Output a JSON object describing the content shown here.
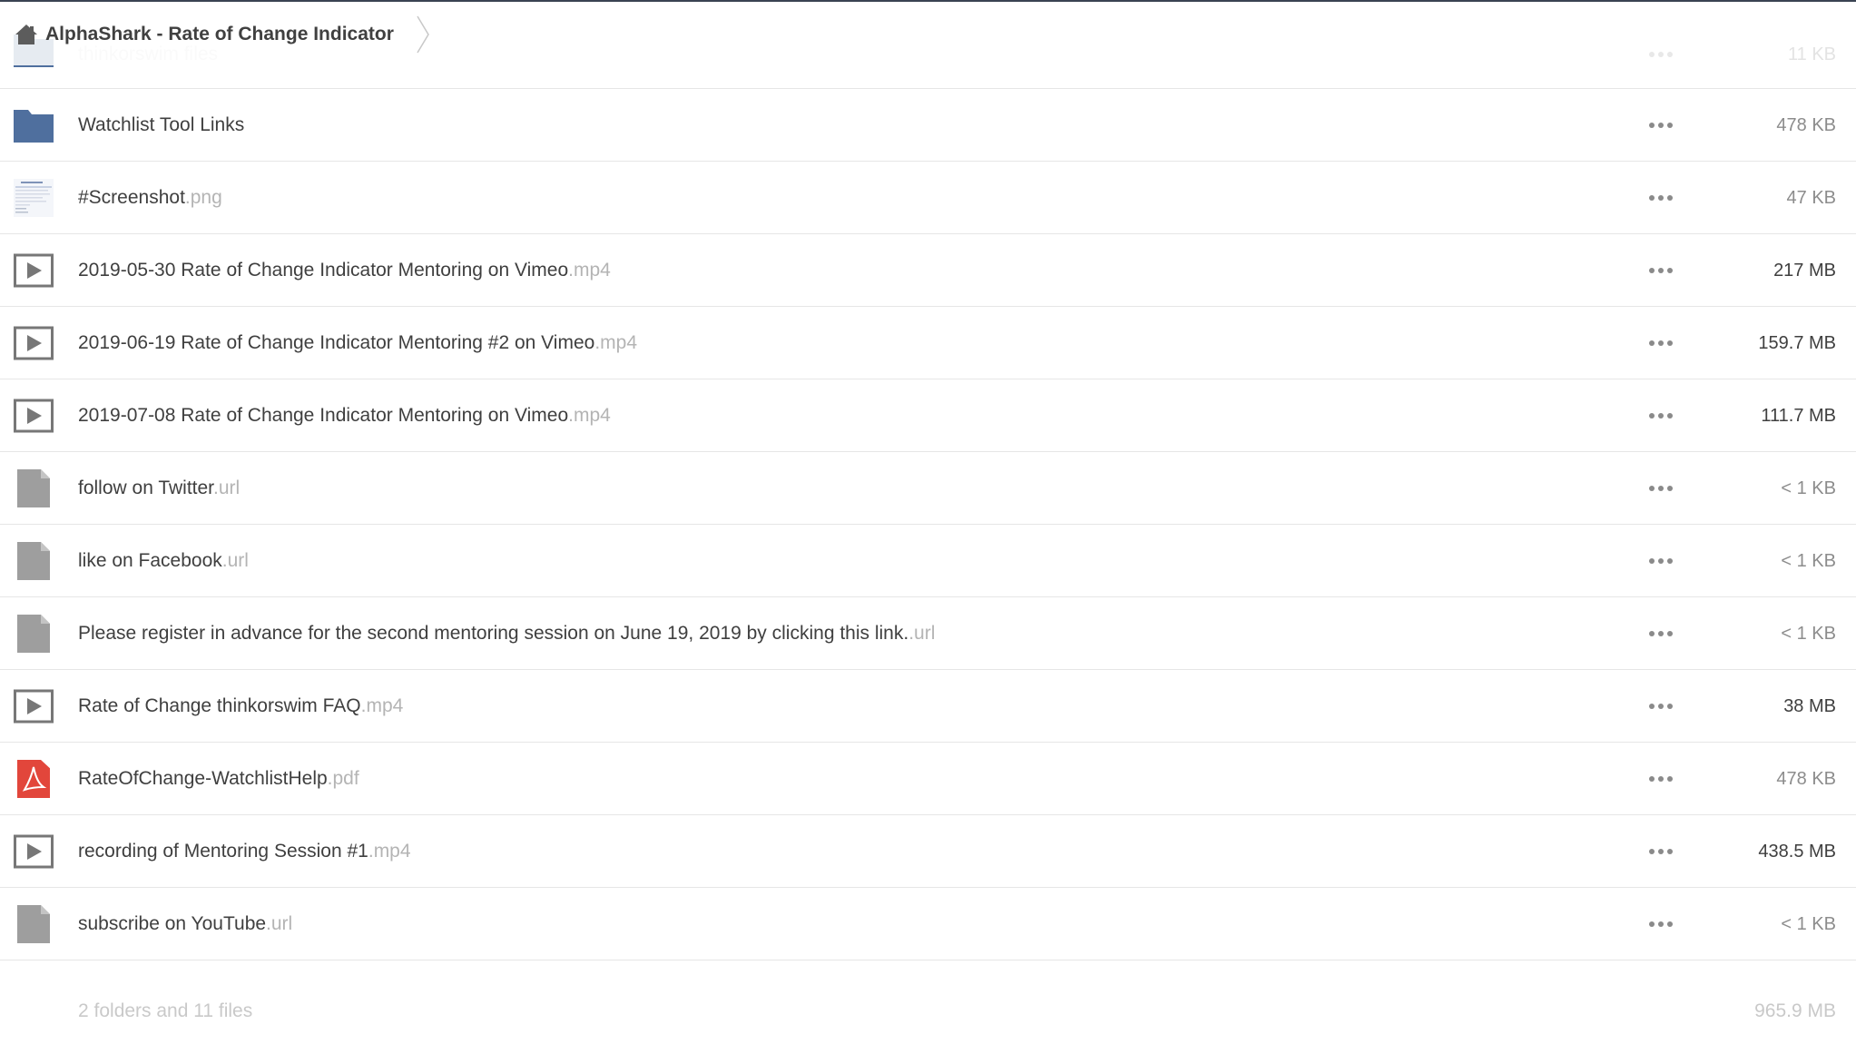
{
  "breadcrumb": {
    "title": "AlphaShark - Rate of Change Indicator",
    "home_icon": "home-icon",
    "separator_icon": "chevron-right-icon"
  },
  "colors": {
    "folder": "#4f6f9e",
    "video_outline": "#777777",
    "generic_file": "#9e9e9e",
    "pdf": "#e2463b",
    "divider": "#e6e6e6",
    "top_border": "#3a4352"
  },
  "files": [
    {
      "name": "thinkorswim files",
      "ext": "",
      "size": "11 KB",
      "icon": "folder-icon",
      "partial": true
    },
    {
      "name": "Watchlist Tool Links",
      "ext": "",
      "size": "478 KB",
      "icon": "folder-icon"
    },
    {
      "name": "#Screenshot",
      "ext": ".png",
      "size": "47 KB",
      "icon": "image-thumbnail-icon"
    },
    {
      "name": "2019-05-30 Rate of Change Indicator Mentoring on Vimeo",
      "ext": ".mp4",
      "size": "217 MB",
      "icon": "video-icon",
      "dark": true
    },
    {
      "name": "2019-06-19 Rate of Change Indicator Mentoring #2 on Vimeo",
      "ext": ".mp4",
      "size": "159.7 MB",
      "icon": "video-icon",
      "dark": true
    },
    {
      "name": "2019-07-08 Rate of Change Indicator Mentoring on Vimeo",
      "ext": ".mp4",
      "size": "111.7 MB",
      "icon": "video-icon",
      "dark": true
    },
    {
      "name": "follow on Twitter",
      "ext": ".url",
      "size": "< 1 KB",
      "icon": "file-icon"
    },
    {
      "name": "like on Facebook",
      "ext": ".url",
      "size": "< 1 KB",
      "icon": "file-icon"
    },
    {
      "name": "Please register in advance for the second mentoring session on June 19, 2019 by clicking this link.",
      "ext": ".url",
      "size": "< 1 KB",
      "icon": "file-icon"
    },
    {
      "name": "Rate of Change thinkorswim FAQ",
      "ext": ".mp4",
      "size": "38 MB",
      "icon": "video-icon",
      "dark": true
    },
    {
      "name": "RateOfChange-WatchlistHelp",
      "ext": ".pdf",
      "size": "478 KB",
      "icon": "pdf-icon"
    },
    {
      "name": "recording of Mentoring Session #1",
      "ext": ".mp4",
      "size": "438.5 MB",
      "icon": "video-icon",
      "dark": true
    },
    {
      "name": "subscribe on YouTube",
      "ext": ".url",
      "size": "< 1 KB",
      "icon": "file-icon"
    }
  ],
  "more_icon": "more-options-icon",
  "footer": {
    "count": "2 folders and 11 files",
    "total": "965.9 MB"
  }
}
